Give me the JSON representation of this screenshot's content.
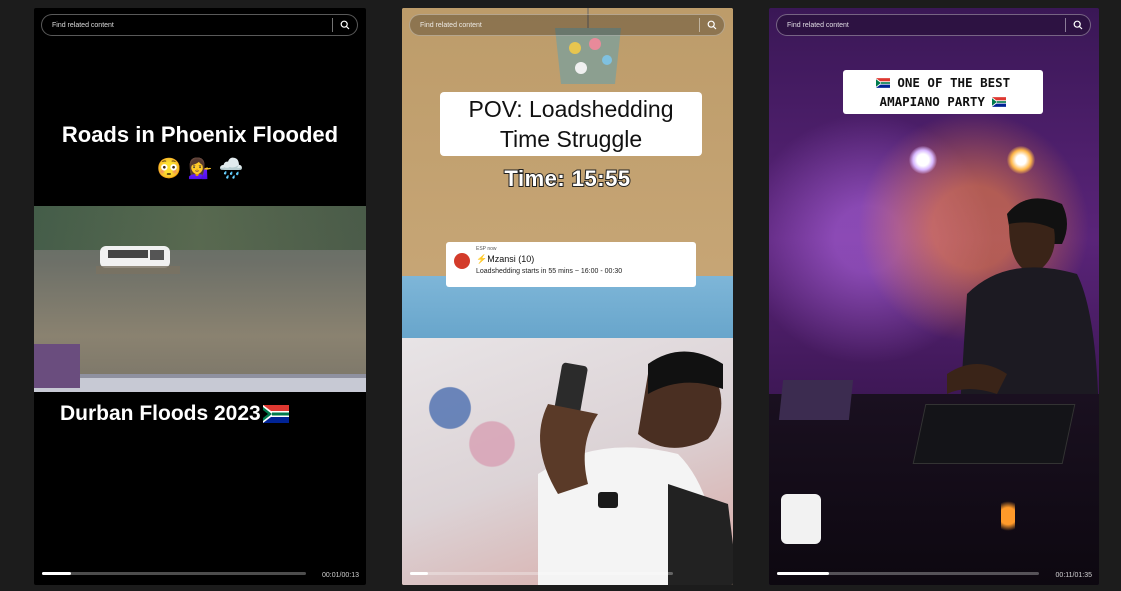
{
  "search": {
    "placeholder": "Find related content",
    "icon": "search-icon"
  },
  "videos": [
    {
      "title": "Roads in Phoenix Flooded",
      "emojis": [
        "😳",
        "💁‍♀️",
        "🌧️"
      ],
      "subtitle": "Durban Floods 2023",
      "time": "00:01/00:13",
      "progress": 0.11
    },
    {
      "title": "POV: Loadshedding Time Struggle",
      "overlay_time": "Time: 15:55",
      "notification": {
        "app": "ESP",
        "app_time": "now",
        "headline": "⚡Mzansi (10)",
        "body": "Loadshedding starts in 55 mins ~ 16:00 - 00:30"
      },
      "time": "",
      "progress": 0.07
    },
    {
      "title": "ONE OF THE BEST AMAPIANO PARTY",
      "time": "00:11/01:35",
      "progress": 0.2
    }
  ],
  "colors": {
    "accent_red": "#d33b2a",
    "club_purple": "#5a2479",
    "flag_green": "#007a4d"
  }
}
